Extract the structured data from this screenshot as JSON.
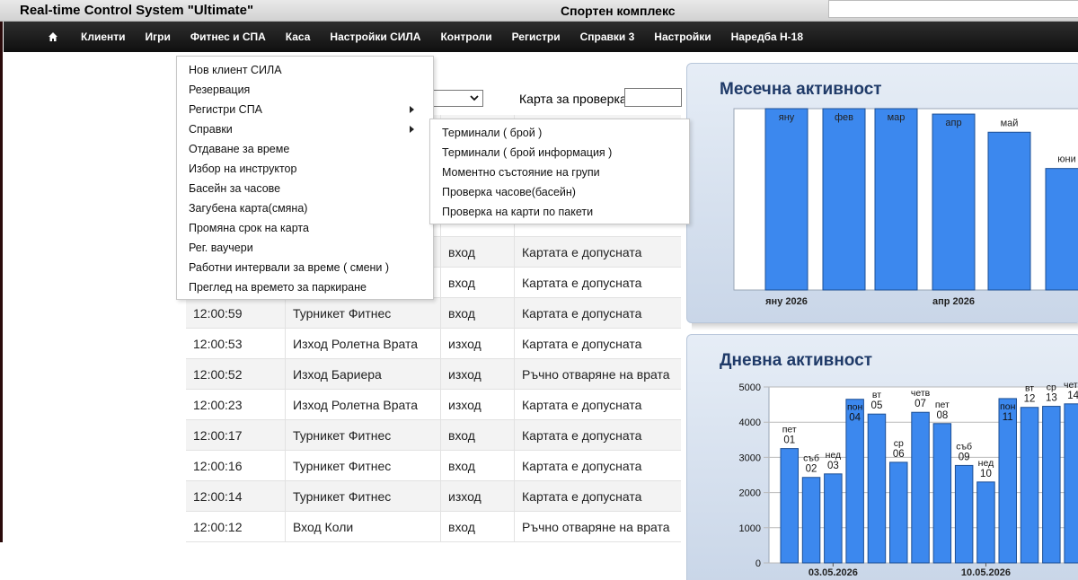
{
  "window": {
    "app_title": "Real-time Control System \"Ultimate\"",
    "facility": "Спортен комплекс"
  },
  "nav": {
    "home_icon": "home-icon",
    "items": [
      {
        "label": "Клиенти"
      },
      {
        "label": "Игри"
      },
      {
        "label": "Фитнес и СПА"
      },
      {
        "label": "Каса"
      },
      {
        "label": "Настройки СИЛА"
      },
      {
        "label": "Контроли"
      },
      {
        "label": "Регистри"
      },
      {
        "label": "Справки 3"
      },
      {
        "label": "Настройки"
      },
      {
        "label": "Наредба Н-18"
      }
    ]
  },
  "filters": {
    "card_label": "Карта за проверка:",
    "card_value": ""
  },
  "menu_main": {
    "items": [
      {
        "label": "Нов клиент СИЛА",
        "has_submenu": false
      },
      {
        "label": "Резервация",
        "has_submenu": false
      },
      {
        "label": "Регистри СПА",
        "has_submenu": true
      },
      {
        "label": "Справки",
        "has_submenu": true
      },
      {
        "label": "Отдаване за време",
        "has_submenu": false
      },
      {
        "label": "Избор на инструктор",
        "has_submenu": false
      },
      {
        "label": "Басейн за часове",
        "has_submenu": false
      },
      {
        "label": "Загубена карта(смяна)",
        "has_submenu": false
      },
      {
        "label": "Промяна срок на карта",
        "has_submenu": false
      },
      {
        "label": "Рег. ваучери",
        "has_submenu": false
      },
      {
        "label": "Работни интервали за време ( смени )",
        "has_submenu": false
      },
      {
        "label": "Преглед на времето за паркиране",
        "has_submenu": false
      }
    ]
  },
  "menu_sub": {
    "items": [
      {
        "label": "Терминали ( брой )"
      },
      {
        "label": "Терминали ( брой информация )"
      },
      {
        "label": "Моментно състояние на групи"
      },
      {
        "label": "Проверка часове(басейн)"
      },
      {
        "label": "Проверка на карти по пакети"
      }
    ]
  },
  "events": {
    "rows": [
      {
        "time": "",
        "device": "",
        "direction": "",
        "status": ""
      },
      {
        "time": "",
        "device": "",
        "direction": "",
        "status": ""
      },
      {
        "time": "",
        "device": "",
        "direction": "",
        "status": ""
      },
      {
        "time": "",
        "device": "",
        "direction": "",
        "status": ""
      },
      {
        "time": "",
        "device": "",
        "direction": "вход",
        "status": "Картата е допусната"
      },
      {
        "time": "",
        "device": "",
        "direction": "вход",
        "status": "Картата е допусната"
      },
      {
        "time": "12:00:59",
        "device": "Турникет Фитнес",
        "direction": "вход",
        "status": "Картата е допусната"
      },
      {
        "time": "12:00:53",
        "device": "Изход Ролетна Врата",
        "direction": "изход",
        "status": "Картата е допусната"
      },
      {
        "time": "12:00:52",
        "device": "Изход Бариера",
        "direction": "изход",
        "status": "Ръчно отваряне на врата"
      },
      {
        "time": "12:00:23",
        "device": "Изход Ролетна Врата",
        "direction": "изход",
        "status": "Картата е допусната"
      },
      {
        "time": "12:00:17",
        "device": "Турникет Фитнес",
        "direction": "вход",
        "status": "Картата е допусната"
      },
      {
        "time": "12:00:16",
        "device": "Турникет Фитнес",
        "direction": "вход",
        "status": "Картата е допусната"
      },
      {
        "time": "12:00:14",
        "device": "Турникет Фитнес",
        "direction": "изход",
        "status": "Картата е допусната"
      },
      {
        "time": "12:00:12",
        "device": "Вход Коли",
        "direction": "вход",
        "status": "Ръчно отваряне на врата"
      }
    ]
  },
  "colors": {
    "bar": "#3c88ee",
    "bar_stroke": "#1d4f94",
    "panel_title": "#1f3a68"
  },
  "chart_data": [
    {
      "type": "bar",
      "title": "Месечна активност",
      "categories": [
        "яну",
        "фев",
        "мар",
        "апр",
        "май",
        "юни"
      ],
      "x_tick_labels": [
        {
          "label": "яну 2026",
          "category": "яну"
        },
        {
          "label": "апр 2026",
          "category": "апр"
        }
      ],
      "values": [
        1.0,
        1.0,
        1.0,
        0.97,
        0.87,
        0.67
      ],
      "value_scale": "relative to plot height (no y axis printed)",
      "grid": false,
      "legend": "none"
    },
    {
      "type": "bar",
      "title": "Дневна активност",
      "categories": [
        "пет 01",
        "съб 02",
        "нед 03",
        "пон 04",
        "вт 05",
        "ср 06",
        "четв 07",
        "пет 08",
        "съб 09",
        "нед 10",
        "пон 11",
        "вт 12",
        "ср 13",
        "четв 14"
      ],
      "category_labels": [
        {
          "day": "пет",
          "num": "01"
        },
        {
          "day": "съб",
          "num": "02"
        },
        {
          "day": "нед",
          "num": "03"
        },
        {
          "day": "пон",
          "num": "04"
        },
        {
          "day": "вт",
          "num": "05"
        },
        {
          "day": "ср",
          "num": "06"
        },
        {
          "day": "четв",
          "num": "07"
        },
        {
          "day": "пет",
          "num": "08"
        },
        {
          "day": "съб",
          "num": "09"
        },
        {
          "day": "нед",
          "num": "10"
        },
        {
          "day": "пон",
          "num": "11"
        },
        {
          "day": "вт",
          "num": "12"
        },
        {
          "day": "ср",
          "num": "13"
        },
        {
          "day": "четв",
          "num": "14"
        }
      ],
      "values": [
        3250,
        2430,
        2530,
        4650,
        4230,
        2860,
        4280,
        3960,
        2770,
        2300,
        4670,
        4420,
        4450,
        4520
      ],
      "ylim": [
        0,
        5000
      ],
      "y_ticks": [
        "0",
        "1000",
        "2000",
        "3000",
        "4000",
        "5000"
      ],
      "x_tick_labels": [
        {
          "label": "03.05.2026",
          "category": "нед 03"
        },
        {
          "label": "10.05.2026",
          "category": "нед 10"
        }
      ],
      "grid": true,
      "legend": "none"
    }
  ]
}
